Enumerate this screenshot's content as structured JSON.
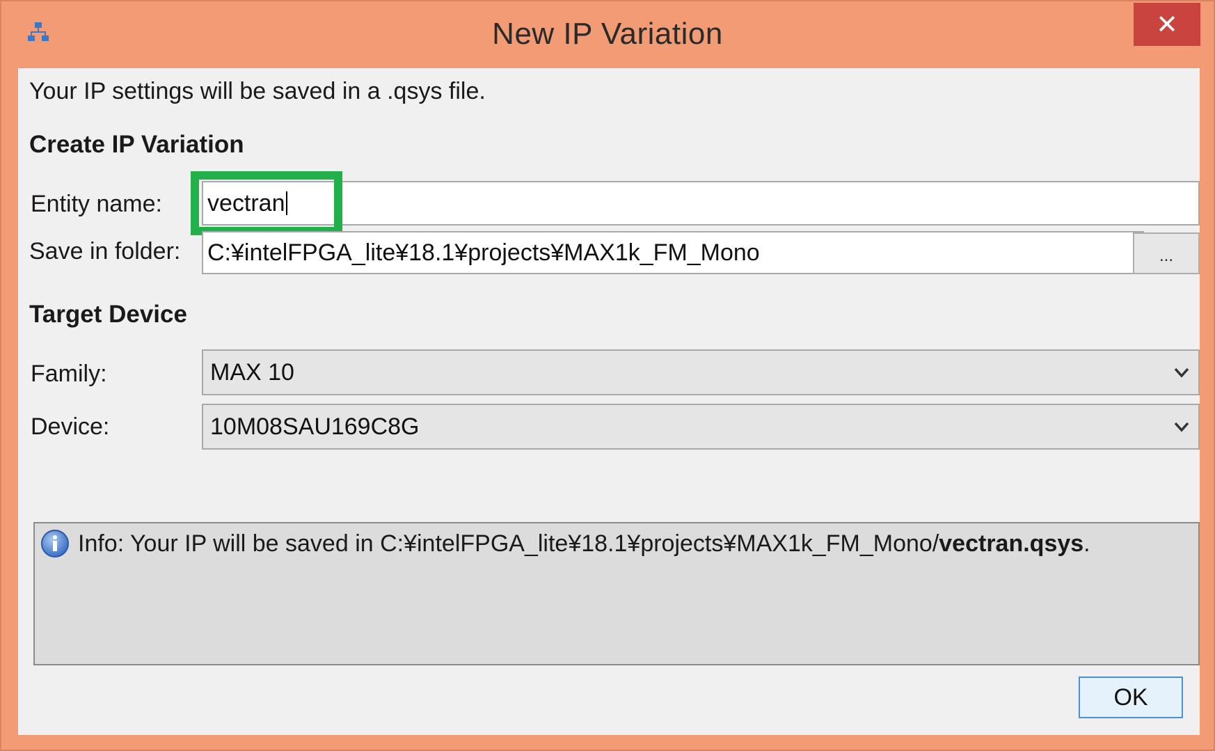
{
  "window": {
    "title": "New IP Variation",
    "close_glyph": "✕",
    "app_icon": "network-hierarchy-icon"
  },
  "intro": "Your IP settings will be saved in a .qsys file.",
  "create_section": {
    "heading": "Create IP Variation",
    "entity_label": "Entity name:",
    "entity_value": "vectran",
    "folder_label": "Save in folder:",
    "folder_value": "C:¥intelFPGA_lite¥18.1¥projects¥MAX1k_FM_Mono",
    "browse_label": "..."
  },
  "target_section": {
    "heading": "Target Device",
    "family_label": "Family:",
    "family_value": "MAX 10",
    "device_label": "Device:",
    "device_value": "10M08SAU169C8G"
  },
  "info": {
    "icon": "info-icon",
    "prefix": "Info: Your IP will be saved in C:¥intelFPGA_lite¥18.1¥projects¥MAX1k_FM_Mono/",
    "filename": "vectran.qsys",
    "suffix": "."
  },
  "ok_label": "OK",
  "colors": {
    "title_bar": "#f29b74",
    "close_button": "#c9433f",
    "highlight": "#22b04a"
  }
}
